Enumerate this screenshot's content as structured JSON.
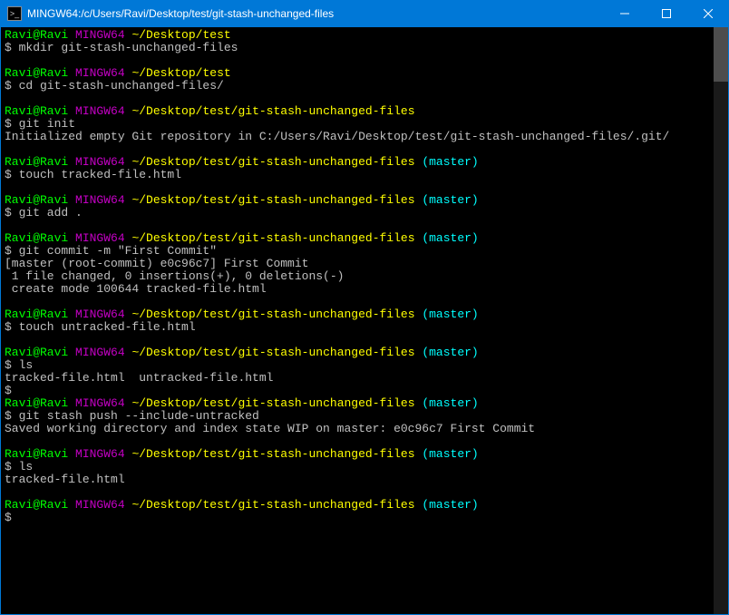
{
  "window": {
    "title": "MINGW64:/c/Users/Ravi/Desktop/test/git-stash-unchanged-files"
  },
  "prompt": {
    "user": "Ravi@Ravi",
    "host": "MINGW64",
    "path_short": "~/Desktop/test",
    "path_long": "~/Desktop/test/git-stash-unchanged-files",
    "branch": "(master)",
    "symbol": "$"
  },
  "blocks": [
    {
      "path": "short",
      "branch": false,
      "cmd": "mkdir git-stash-unchanged-files",
      "output": []
    },
    {
      "path": "short",
      "branch": false,
      "cmd": "cd git-stash-unchanged-files/",
      "output": []
    },
    {
      "path": "long",
      "branch": false,
      "cmd": "git init",
      "output": [
        "Initialized empty Git repository in C:/Users/Ravi/Desktop/test/git-stash-unchanged-files/.git/"
      ]
    },
    {
      "path": "long",
      "branch": true,
      "cmd": "touch tracked-file.html",
      "output": []
    },
    {
      "path": "long",
      "branch": true,
      "cmd": "git add .",
      "output": []
    },
    {
      "path": "long",
      "branch": true,
      "cmd": "git commit -m \"First Commit\"",
      "output": [
        "[master (root-commit) e0c96c7] First Commit",
        " 1 file changed, 0 insertions(+), 0 deletions(-)",
        " create mode 100644 tracked-file.html"
      ]
    },
    {
      "path": "long",
      "branch": true,
      "cmd": "touch untracked-file.html",
      "output": []
    },
    {
      "path": "long",
      "branch": true,
      "cmd": "ls",
      "output": [
        "tracked-file.html  untracked-file.html",
        "$"
      ],
      "raw_last": true
    },
    {
      "path": "long",
      "branch": true,
      "cmd": "git stash push --include-untracked",
      "output": [
        "Saved working directory and index state WIP on master: e0c96c7 First Commit"
      ],
      "no_gap_before": true
    },
    {
      "path": "long",
      "branch": true,
      "cmd": "ls",
      "output": [
        "tracked-file.html"
      ]
    },
    {
      "path": "long",
      "branch": true,
      "cmd": "",
      "output": []
    }
  ]
}
